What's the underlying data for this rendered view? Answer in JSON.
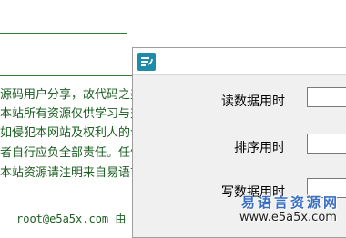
{
  "background_page": {
    "notice_lines": [
      "源码用户分享，故代码之美",
      "本站所有资源仅供学习与交",
      "如侵犯本网站及权利人的合",
      "者自行应负全部责任。任何人",
      "本站资源请注明来自易语言源"
    ],
    "footer_email": "root@e5a5x.com 由"
  },
  "dialog": {
    "icon": "app-logo-icon",
    "rows": [
      {
        "label": "读数据用时",
        "value": ""
      },
      {
        "label": "排序用时",
        "value": ""
      },
      {
        "label": "写数据用时",
        "value": ""
      }
    ]
  },
  "watermark": {
    "title": "易语言资源网",
    "url": "www.e5a5x.com"
  },
  "colors": {
    "page_text": "#1b5e20",
    "dialog_bg": "#f0f0f0",
    "icon_bg": "#1e8ca8",
    "watermark": "#3a6fc4"
  }
}
